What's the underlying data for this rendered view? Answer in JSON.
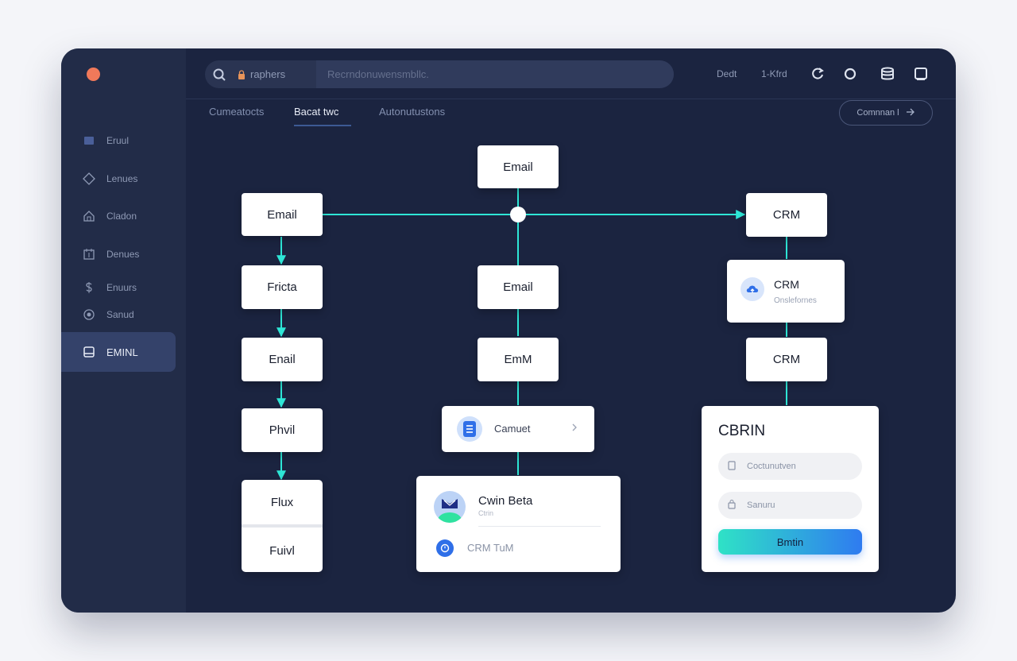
{
  "topbar": {
    "search_scope": "raphers",
    "search_placeholder": "Recrndonuwensmbllc.",
    "link_1": "Dedt",
    "link_2": "1-Kfrd",
    "icons": [
      "refresh-icon",
      "circle-icon",
      "database-icon",
      "window-icon"
    ]
  },
  "sidebar": {
    "items": [
      {
        "label": "Eruul",
        "icon": "square-icon"
      },
      {
        "label": "Lenues",
        "icon": "diamond-icon"
      },
      {
        "label": "Cladon",
        "icon": "home-icon"
      },
      {
        "label": "Denues",
        "icon": "calendar-icon"
      },
      {
        "label": "Enuurs",
        "icon": "dollar-icon"
      },
      {
        "label": "Sanud",
        "icon": "target-icon"
      },
      {
        "label": "EMINL",
        "icon": "inbox-icon"
      }
    ],
    "active_index": 6
  },
  "tabs": [
    "Cumeatocts",
    "Bacat twc",
    "Autonutustons"
  ],
  "active_tab": 1,
  "cta": {
    "label": "Comnnan l"
  },
  "flow": {
    "col1": [
      "Email",
      "Fricta",
      "Enail",
      "Phvil",
      "Flux",
      "Fuivl"
    ],
    "col2": [
      "Email",
      "Email",
      "EmM"
    ],
    "col2_card": {
      "label": "Camuet"
    },
    "col2_profile": {
      "title": "Cwin Beta",
      "subtitle": "Ctrin",
      "row": "CRM TuM"
    },
    "col3": [
      "CRM",
      "CRM",
      "CRM"
    ],
    "col3_card": {
      "subtitle": "Onslefornes"
    },
    "form": {
      "title": "CBRIN",
      "field1_placeholder": "Coctunutven",
      "field2_placeholder": "Sanuru",
      "submit_label": "Bmtin"
    }
  },
  "colors": {
    "window_bg": "#1b2440",
    "sidebar_bg": "#222c48",
    "connector": "#2ee6d6",
    "accent": "#2f7bf0",
    "dot": "#f0795a"
  }
}
